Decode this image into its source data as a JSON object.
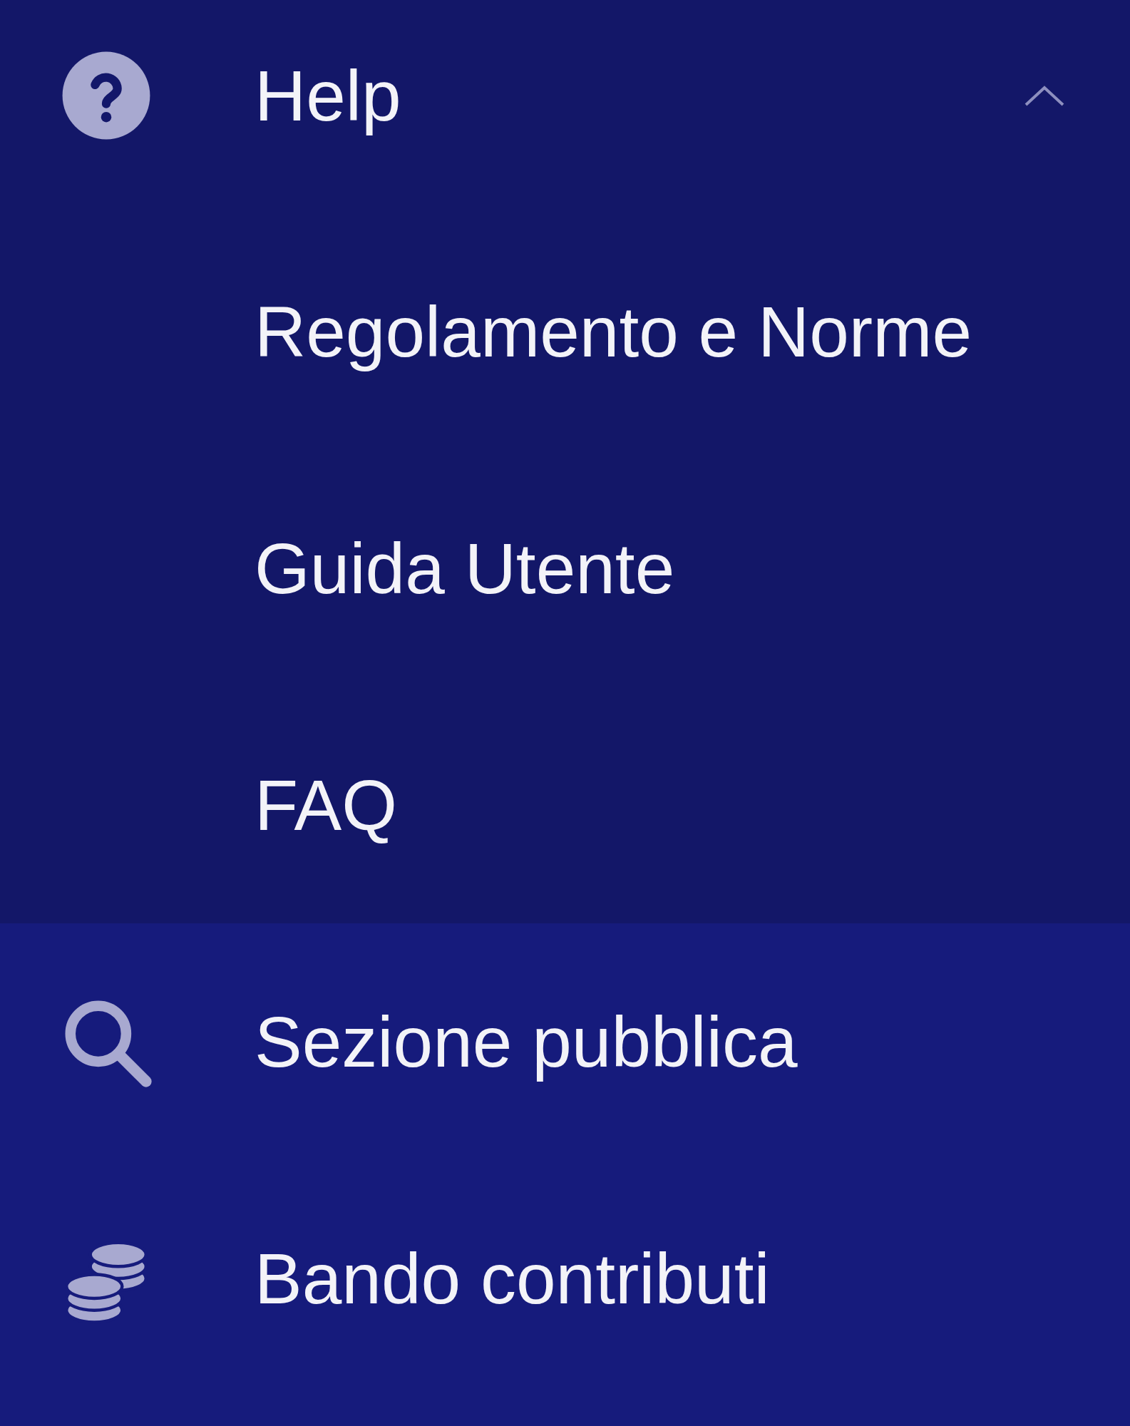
{
  "menu": [
    {
      "label": "Help",
      "expanded": true,
      "children": [
        {
          "label": "Regolamento e Norme"
        },
        {
          "label": "Guida Utente"
        },
        {
          "label": "FAQ"
        }
      ]
    },
    {
      "label": "Sezione pubblica"
    },
    {
      "label": "Bando contributi"
    }
  ]
}
